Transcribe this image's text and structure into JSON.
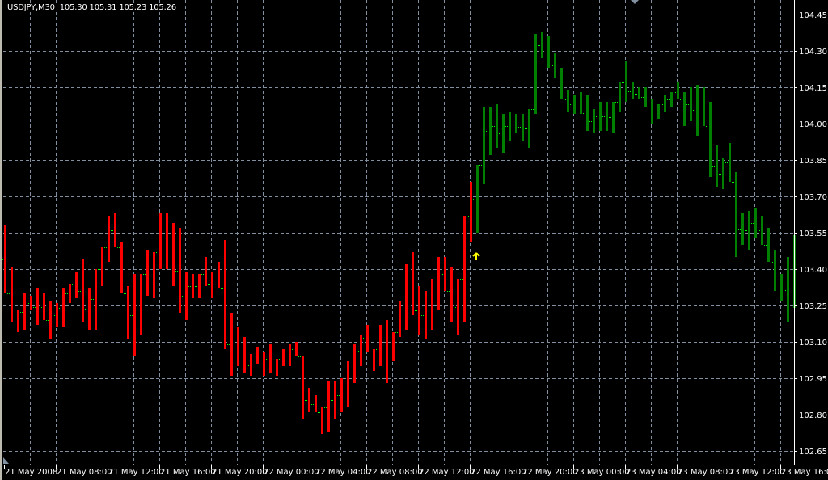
{
  "header": {
    "symbol": "USDJPY,M30",
    "open": "105.30",
    "high": "105.31",
    "low": "105.23",
    "close": "105.26"
  },
  "colors": {
    "background": "#000000",
    "grid": "#8090a0",
    "bear": "#ff0000",
    "bull": "#008000",
    "tick": "#00ff00",
    "arrow": "#ffff00",
    "axis": "#ffffff"
  },
  "chart_data": {
    "type": "ohlc-bar",
    "title": "USDJPY,M30",
    "timeframe_minutes": 30,
    "ylim": [
      102.65,
      104.45
    ],
    "y_ticks": [
      "104.45",
      "104.30",
      "104.15",
      "104.00",
      "103.85",
      "103.70",
      "103.55",
      "103.40",
      "103.25",
      "103.10",
      "102.95",
      "102.80",
      "102.65"
    ],
    "x_ticks": [
      "21 May 2008",
      "21 May 08:00",
      "21 May 12:00",
      "21 May 16:00",
      "21 May 20:00",
      "22 May 00:00",
      "22 May 04:00",
      "22 May 08:00",
      "22 May 12:00",
      "22 May 16:00",
      "22 May 20:00",
      "23 May 00:00",
      "23 May 04:00",
      "23 May 08:00",
      "23 May 12:00",
      "23 May 16:00"
    ],
    "x_tick_every_bars": 8,
    "grid": true,
    "signal": {
      "type": "buy-arrow",
      "bar_index": 73,
      "price": 103.45
    },
    "color_change_bar_index": 73,
    "high": [
      103.58,
      103.41,
      103.23,
      103.3,
      103.29,
      103.32,
      103.3,
      103.27,
      103.26,
      103.32,
      103.34,
      103.39,
      103.44,
      103.32,
      103.4,
      103.49,
      103.62,
      103.63,
      103.51,
      103.33,
      103.38,
      103.38,
      103.48,
      103.47,
      103.63,
      103.63,
      103.59,
      103.57,
      103.39,
      103.38,
      103.38,
      103.45,
      103.39,
      103.43,
      103.52,
      103.22,
      103.16,
      103.12,
      103.05,
      103.08,
      103.06,
      103.09,
      103.03,
      103.07,
      103.09,
      103.1,
      103.04,
      102.91,
      102.88,
      102.83,
      102.94,
      102.94,
      102.95,
      103.02,
      103.09,
      103.13,
      103.17,
      103.07,
      103.17,
      103.19,
      103.14,
      103.27,
      103.42,
      103.47,
      103.33,
      103.31,
      103.36,
      103.45,
      103.45,
      103.41,
      103.36,
      103.62,
      103.76,
      103.83,
      104.07,
      104.07,
      104.08,
      104.04,
      104.05,
      104.04,
      104.04,
      104.06,
      104.37,
      104.38,
      104.36,
      104.29,
      104.23,
      104.14,
      104.12,
      104.13,
      104.12,
      104.06,
      104.09,
      104.09,
      104.09,
      104.17,
      104.26,
      104.17,
      104.15,
      104.15,
      104.1,
      104.08,
      104.12,
      104.13,
      104.17,
      104.13,
      104.15,
      104.16,
      104.15,
      104.09,
      103.91,
      103.86,
      103.92,
      103.8,
      103.63,
      103.64,
      103.65,
      103.62,
      103.57,
      103.48,
      103.38,
      103.45,
      103.54
    ],
    "low": [
      103.3,
      103.18,
      103.14,
      103.15,
      103.23,
      103.17,
      103.19,
      103.11,
      103.16,
      103.16,
      103.26,
      103.28,
      103.18,
      103.15,
      103.15,
      103.33,
      103.43,
      103.49,
      103.3,
      103.11,
      103.04,
      103.13,
      103.29,
      103.28,
      103.4,
      103.4,
      103.33,
      103.22,
      103.19,
      103.28,
      103.28,
      103.33,
      103.28,
      103.32,
      103.07,
      102.96,
      103.0,
      102.97,
      102.96,
      103.01,
      102.96,
      102.97,
      102.96,
      103.0,
      103.0,
      103.04,
      102.78,
      102.81,
      102.81,
      102.72,
      102.73,
      102.78,
      102.81,
      102.83,
      102.93,
      103.0,
      103.06,
      102.98,
      103.0,
      102.93,
      103.02,
      103.12,
      103.15,
      103.21,
      103.13,
      103.11,
      103.15,
      103.23,
      103.31,
      103.18,
      103.13,
      103.18,
      103.51,
      103.55,
      103.75,
      103.87,
      103.9,
      103.88,
      103.93,
      103.96,
      103.93,
      103.9,
      104.04,
      104.27,
      104.23,
      104.19,
      104.1,
      104.05,
      104.04,
      104.04,
      103.97,
      103.96,
      103.97,
      103.97,
      103.96,
      104.05,
      104.09,
      104.1,
      104.1,
      104.07,
      104.0,
      104.02,
      104.05,
      104.07,
      104.1,
      103.99,
      104.01,
      103.95,
      103.99,
      103.78,
      103.74,
      103.73,
      103.76,
      103.45,
      103.5,
      103.48,
      103.53,
      103.5,
      103.43,
      103.31,
      103.27,
      103.18,
      103.24
    ]
  }
}
